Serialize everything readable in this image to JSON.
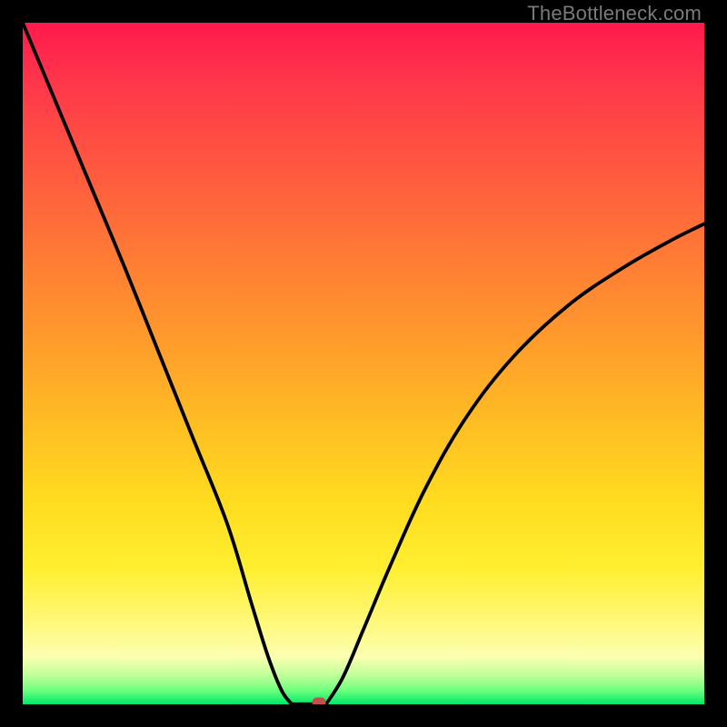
{
  "watermark": "TheBottleneck.com",
  "chart_data": {
    "type": "line",
    "title": "",
    "xlabel": "",
    "ylabel": "",
    "xlim": [
      0,
      1
    ],
    "ylim": [
      0,
      1
    ],
    "grid": false,
    "legend": false,
    "background_gradient": {
      "orientation": "vertical",
      "stops": [
        {
          "pos": 0.0,
          "color": "#ff1a4d"
        },
        {
          "pos": 0.5,
          "color": "#ffaa28"
        },
        {
          "pos": 0.8,
          "color": "#ffef30"
        },
        {
          "pos": 0.93,
          "color": "#fcffb0"
        },
        {
          "pos": 1.0,
          "color": "#00e868"
        }
      ]
    },
    "series": [
      {
        "name": "left-branch",
        "x": [
          0.0,
          0.05,
          0.1,
          0.15,
          0.2,
          0.25,
          0.3,
          0.335,
          0.36,
          0.38,
          0.395
        ],
        "y": [
          1.0,
          0.88,
          0.76,
          0.64,
          0.515,
          0.39,
          0.265,
          0.15,
          0.07,
          0.02,
          0.0
        ]
      },
      {
        "name": "valley-floor",
        "x": [
          0.395,
          0.445
        ],
        "y": [
          0.0,
          0.0
        ]
      },
      {
        "name": "right-branch",
        "x": [
          0.445,
          0.47,
          0.5,
          0.54,
          0.59,
          0.65,
          0.72,
          0.8,
          0.88,
          0.95,
          1.0
        ],
        "y": [
          0.0,
          0.04,
          0.11,
          0.205,
          0.315,
          0.42,
          0.51,
          0.585,
          0.64,
          0.68,
          0.705
        ]
      }
    ],
    "marker": {
      "x": 0.435,
      "y": 0.003,
      "color": "#c0504c"
    }
  }
}
